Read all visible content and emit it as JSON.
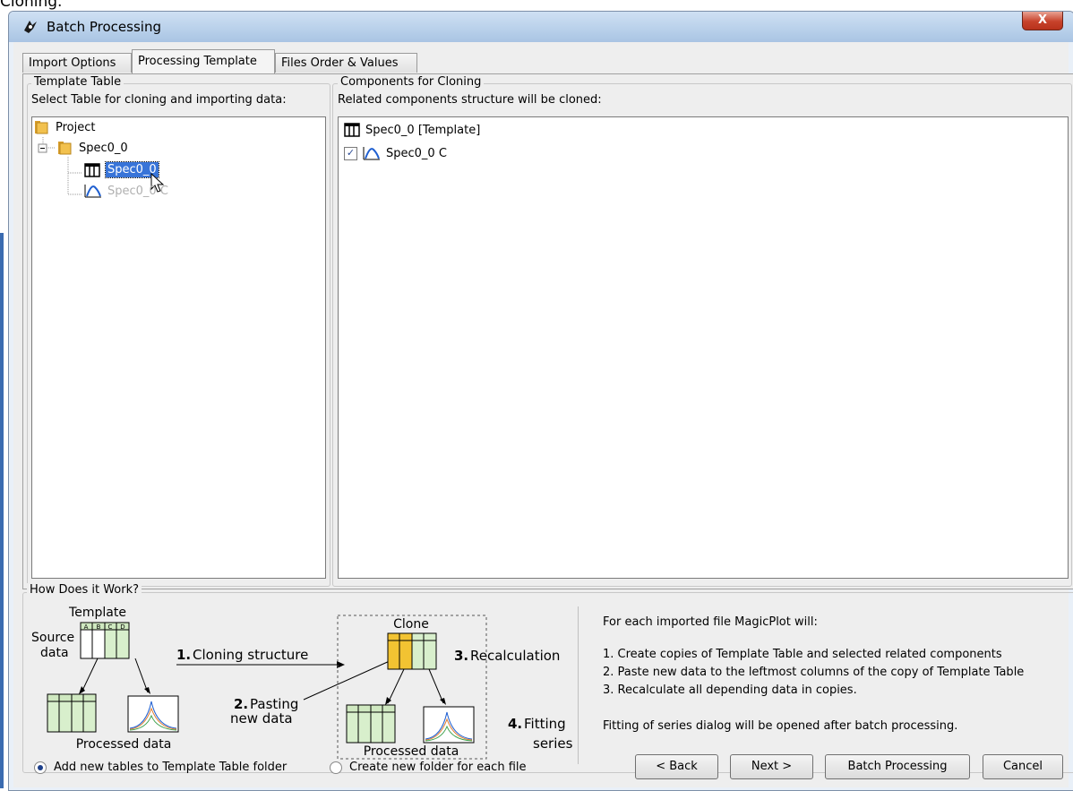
{
  "top_text": "Cloning.",
  "window": {
    "title": "Batch Processing",
    "close_label": "X"
  },
  "tabs": [
    {
      "label": "Import Options"
    },
    {
      "label": "Processing Template"
    },
    {
      "label": "Files Order & Values"
    }
  ],
  "template_table": {
    "group_title": "Template Table",
    "instruction": "Select Table for cloning and importing data:",
    "tree": {
      "root": "Project",
      "folder": "Spec0_0",
      "table": "Spec0_0",
      "fit": "Spec0_0 C"
    }
  },
  "components": {
    "group_title": "Components for Cloning",
    "instruction": "Related components structure will be cloned:",
    "items": [
      {
        "label": "Spec0_0 [Template]",
        "checked": null
      },
      {
        "label": "Spec0_0 C",
        "checked": true
      }
    ]
  },
  "how": {
    "group_title": "How Does it Work?",
    "diagram": {
      "template_label": "Template",
      "source_label_1": "Source",
      "source_label_2": "data",
      "step1_num": "1.",
      "step1_text": "Cloning structure",
      "clone_label": "Clone",
      "step3_num": "3.",
      "step3_text": "Recalculation",
      "step2_num": "2.",
      "step2_text_1": "Pasting",
      "step2_text_2": "new data",
      "step4_num": "4.",
      "step4_text_1": "Fitting",
      "step4_text_2": "series",
      "processed_left": "Processed data",
      "processed_right": "Processed data",
      "cols": [
        "A",
        "B",
        "C",
        "D"
      ]
    },
    "info_title": "For each imported file MagicPlot will:",
    "info_lines": [
      "1. Create copies of Template Table and selected related components",
      "2. Paste new data to the leftmost columns of the copy of Template Table",
      "3. Recalculate all depending data in copies."
    ],
    "info_footer": "Fitting of series dialog will be opened after batch processing."
  },
  "options": {
    "radio_add": "Add new tables to Template Table folder",
    "radio_create": "Create new folder for each file",
    "selected": "add"
  },
  "buttons": {
    "back": "< Back",
    "next": "Next >",
    "batch": "Batch Processing",
    "cancel": "Cancel"
  }
}
